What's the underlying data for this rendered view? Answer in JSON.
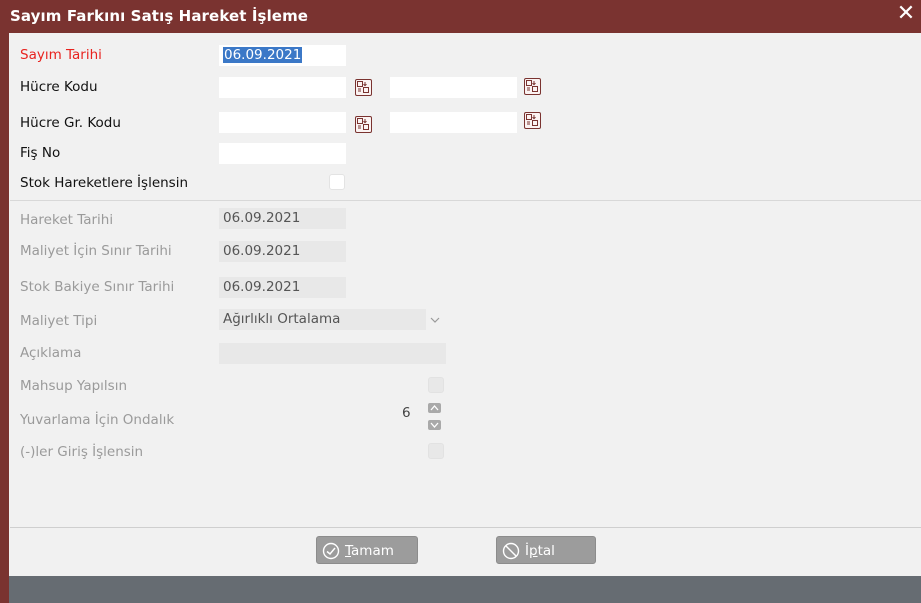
{
  "window": {
    "title": "Sayım Farkını Satış Hareket İşleme",
    "close_glyph": "✕"
  },
  "form": {
    "sayim_tarihi": {
      "label": "Sayım Tarihi",
      "value": "06.09.2021"
    },
    "hucre_kodu": {
      "label": "Hücre Kodu",
      "value_from": "",
      "value_to": ""
    },
    "hucre_gr_kodu": {
      "label": "Hücre Gr. Kodu",
      "value_from": "",
      "value_to": ""
    },
    "fis_no": {
      "label": "Fiş No",
      "value": ""
    },
    "stok_hareketlere": {
      "label": "Stok Hareketlere İşlensin",
      "checked": false
    }
  },
  "disabled_section": {
    "hareket_tarihi": {
      "label": "Hareket Tarihi",
      "value": "06.09.2021"
    },
    "maliyet_sinir": {
      "label": "Maliyet İçin Sınır Tarihi",
      "value": "06.09.2021"
    },
    "stok_bakiye_sinir": {
      "label": "Stok Bakiye Sınır Tarihi",
      "value": "06.09.2021"
    },
    "maliyet_tipi": {
      "label": "Maliyet Tipi",
      "value": "Ağırlıklı Ortalama"
    },
    "aciklama": {
      "label": "Açıklama",
      "value": ""
    },
    "mahsup": {
      "label": "Mahsup Yapılsın",
      "checked": false
    },
    "yuvarlama": {
      "label": "Yuvarlama İçin Ondalık",
      "value": "6"
    },
    "giris": {
      "label": "(-)ler Giriş İşlensin",
      "checked": false
    }
  },
  "buttons": {
    "ok": {
      "accel": "T",
      "rest": "amam"
    },
    "cancel": {
      "pre": "İ",
      "accel": "p",
      "rest": "tal"
    }
  },
  "colors": {
    "frame": "#7a3330",
    "required_label": "#e8231f",
    "selection": "#3b78c7",
    "statusbar": "#666c72"
  },
  "icons": [
    "close-icon",
    "picker-icon",
    "chevron-down-icon",
    "spin-up-icon",
    "spin-down-icon",
    "check-circle-icon",
    "cancel-circle-icon"
  ]
}
